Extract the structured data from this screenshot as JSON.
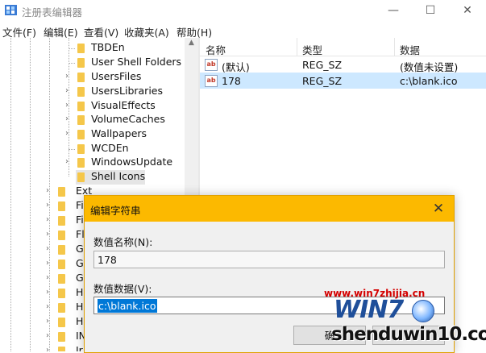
{
  "window": {
    "title": "注册表编辑器",
    "minimize_glyph": "—",
    "maximize_glyph": "☐",
    "close_glyph": "✕"
  },
  "menu": [
    "文件(F)",
    "编辑(E)",
    "查看(V)",
    "收藏夹(A)",
    "帮助(H)"
  ],
  "tree": {
    "items": [
      "TBDEn",
      "User Shell Folders",
      "UsersFiles",
      "UsersLibraries",
      "VisualEffects",
      "VolumeCaches",
      "Wallpapers",
      "WCDEn",
      "WindowsUpdate",
      "Shell Icons"
    ],
    "selected": "Shell Icons",
    "lower_items": [
      "Ext",
      "Fi",
      "Fi",
      "Fl",
      "G",
      "G",
      "G",
      "H",
      "H",
      "H",
      "IN",
      "Ir"
    ]
  },
  "list": {
    "columns": [
      "名称",
      "类型",
      "数据"
    ],
    "rows": [
      {
        "name": "(默认)",
        "type": "REG_SZ",
        "data": "(数值未设置)",
        "icon": "string-value-icon"
      },
      {
        "name": "178",
        "type": "REG_SZ",
        "data": "c:\\blank.ico",
        "icon": "string-value-icon",
        "selected": true
      }
    ]
  },
  "dialog": {
    "title": "编辑字符串",
    "close_glyph": "✕",
    "name_label": "数值名称(N):",
    "name_value": "178",
    "data_label": "数值数据(V):",
    "data_value": "c:\\blank.ico",
    "ok_label": "确"
  },
  "watermark": {
    "url": "www.win7zhijia.cn",
    "logo": "WIN7",
    "site": "shenduwin10.com"
  },
  "colors": {
    "dialog_title_bg": "#fcb900",
    "selection": "#0078d7",
    "row_selected": "#cde8ff"
  }
}
